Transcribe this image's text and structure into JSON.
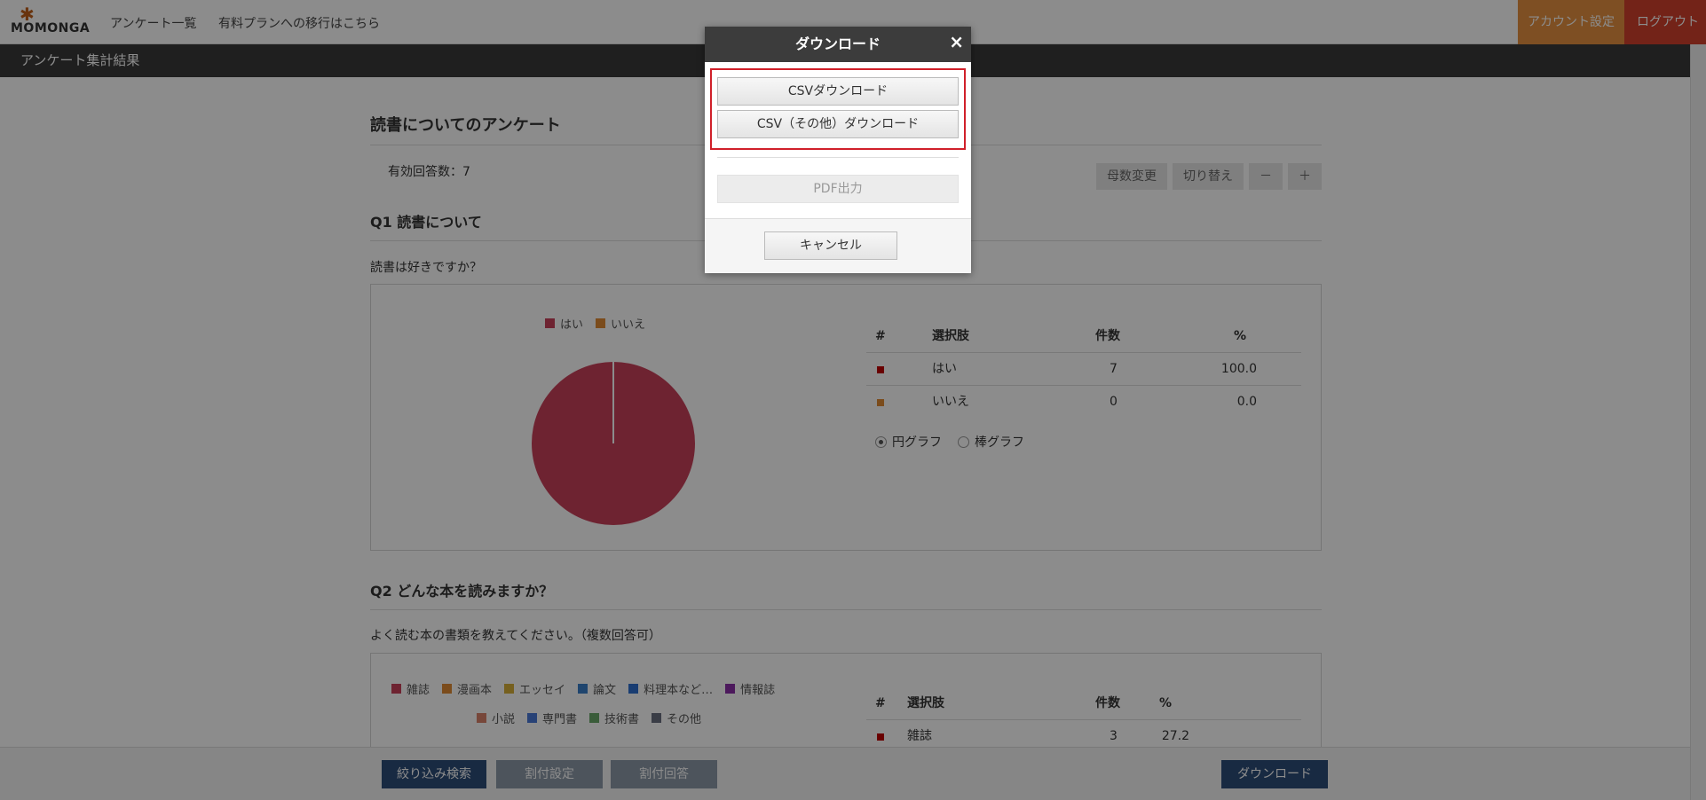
{
  "nav": {
    "logo_text": "MOMONGA",
    "links": [
      "アンケート一覧",
      "有料プランへの移行はこちら"
    ],
    "account_label": "アカウント設定",
    "logout_label": "ログアウト"
  },
  "subheader": {
    "title": "アンケート集計結果"
  },
  "survey": {
    "title": "読書についてのアンケート",
    "response_count": "有効回答数：7",
    "tools": [
      "母数変更",
      "切り替え",
      "－",
      "＋"
    ]
  },
  "q1": {
    "title": "Q1 読書について",
    "question": "読書は好きですか？",
    "legend": [
      {
        "label": "はい",
        "color": "#c9405a"
      },
      {
        "label": "いいえ",
        "color": "#e08a33"
      }
    ],
    "table_headers": [
      "#",
      "選択肢",
      "件数",
      "%"
    ],
    "rows": [
      {
        "choice": "はい",
        "count": "7",
        "pct": "100.0",
        "color": "#c00000"
      },
      {
        "choice": "いいえ",
        "count": "0",
        "pct": "0.0",
        "color": "#e08a33"
      }
    ],
    "chart_options": [
      "円グラフ",
      "棒グラフ"
    ]
  },
  "q2": {
    "title": "Q2 どんな本を読みますか？",
    "question": "よく読む本の書類を教えてください。（複数回答可）",
    "legend_row1": [
      {
        "label": "雑誌",
        "color": "#c9405a"
      },
      {
        "label": "漫画本",
        "color": "#e08a33"
      },
      {
        "label": "エッセイ",
        "color": "#d8b03a"
      },
      {
        "label": "論文",
        "color": "#3a7fc9"
      },
      {
        "label": "料理本など…",
        "color": "#2f6fd0"
      },
      {
        "label": "情報誌",
        "color": "#8a2fa8"
      }
    ],
    "legend_row2": [
      {
        "label": "小説",
        "color": "#d9826a"
      },
      {
        "label": "専門書",
        "color": "#4a78d8"
      },
      {
        "label": "技術書",
        "color": "#6aa86a"
      },
      {
        "label": "その他",
        "color": "#6a7080"
      }
    ],
    "table_headers": [
      "#",
      "選択肢",
      "件数",
      "%"
    ],
    "rows": [
      {
        "choice": "雑誌",
        "count": "3",
        "pct": "27.2",
        "color": "#c00000"
      }
    ]
  },
  "chart_data": {
    "type": "pie",
    "categories": [
      "はい",
      "いいえ"
    ],
    "values": [
      7,
      0
    ],
    "colors": [
      "#c9405a",
      "#e08a33"
    ]
  },
  "bottom": {
    "filter_label": "絞り込み検索",
    "split_setting_label": "割付設定",
    "split_answer_label": "割付回答",
    "download_label": "ダウンロード"
  },
  "modal": {
    "title": "ダウンロード",
    "close_glyph": "×",
    "csv_label": "CSVダウンロード",
    "csv_other_label": "CSV（その他）ダウンロード",
    "pdf_label": "PDF出力",
    "cancel_label": "キャンセル"
  }
}
